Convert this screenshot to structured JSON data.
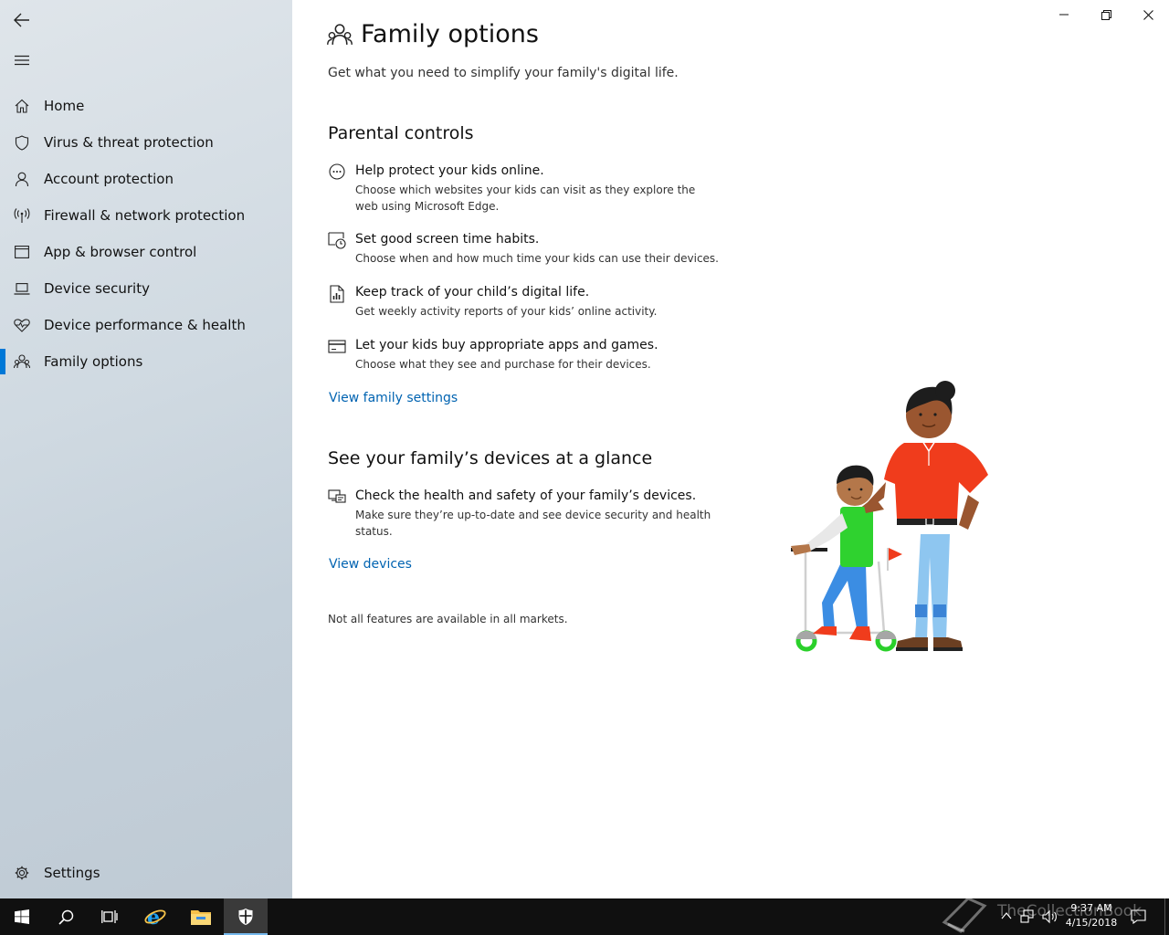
{
  "sidebar": {
    "back_icon": "back-arrow-icon",
    "menu_icon": "hamburger-icon",
    "items": [
      {
        "label": "Home",
        "icon": "home-icon"
      },
      {
        "label": "Virus & threat protection",
        "icon": "shield-icon"
      },
      {
        "label": "Account protection",
        "icon": "person-icon"
      },
      {
        "label": "Firewall & network protection",
        "icon": "antenna-icon"
      },
      {
        "label": "App & browser control",
        "icon": "browser-window-icon"
      },
      {
        "label": "Device security",
        "icon": "laptop-icon"
      },
      {
        "label": "Device performance & health",
        "icon": "heart-pulse-icon"
      },
      {
        "label": "Family options",
        "icon": "family-icon",
        "selected": true
      }
    ],
    "settings": {
      "label": "Settings",
      "icon": "gear-icon"
    }
  },
  "window": {
    "minimize_icon": "minimize-icon",
    "restore_icon": "restore-icon",
    "close_icon": "close-icon"
  },
  "main": {
    "title": "Family options",
    "subtitle": "Get what you need to simplify your family's digital life.",
    "parental": {
      "heading": "Parental controls",
      "features": [
        {
          "icon": "web-bubble-icon",
          "title": "Help protect your kids online.",
          "desc": "Choose which websites your kids can visit as they explore the web using Microsoft Edge."
        },
        {
          "icon": "screen-clock-icon",
          "title": "Set good screen time habits.",
          "desc": "Choose when and how much time your kids can use their devices."
        },
        {
          "icon": "report-icon",
          "title": "Keep track of your child’s digital life.",
          "desc": "Get weekly activity reports of your kids’ online activity."
        },
        {
          "icon": "credit-card-icon",
          "title": "Let your kids buy appropriate apps and games.",
          "desc": "Choose what they see and purchase for their devices."
        }
      ],
      "link": "View family settings"
    },
    "devices": {
      "heading": "See your family’s devices at a glance",
      "feature": {
        "icon": "devices-icon",
        "title": "Check the health and safety of your family’s devices.",
        "desc": "Make sure they’re up-to-date and see device security and health status."
      },
      "link": "View devices"
    },
    "footnote": "Not all features are available in all markets."
  },
  "taskbar": {
    "items": [
      "windows-start-icon",
      "search-icon",
      "task-view-icon",
      "internet-explorer-icon",
      "file-explorer-icon",
      "windows-defender-icon"
    ],
    "time": "9:37 AM",
    "date": "4/15/2018",
    "watermark": "TheCollectionBook"
  },
  "colors": {
    "accent": "#0078d7",
    "link": "#0063b1",
    "taskbar": "#101010"
  }
}
